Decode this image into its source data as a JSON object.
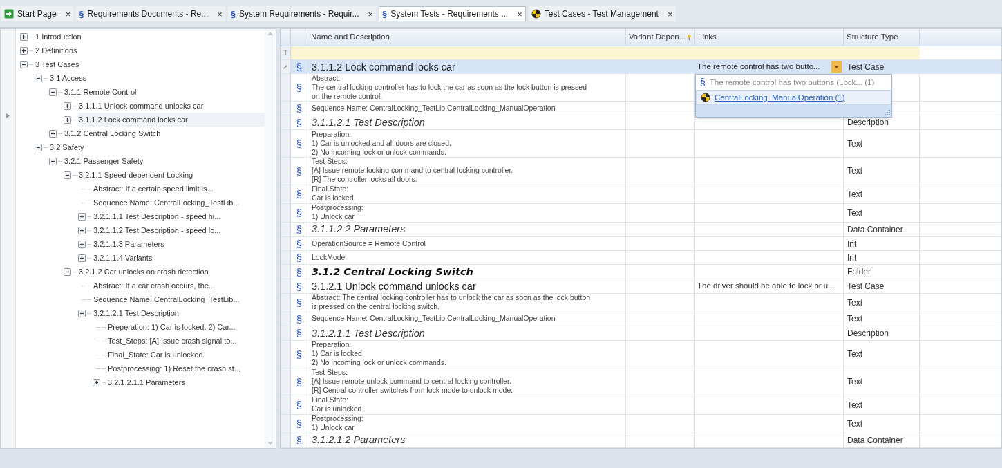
{
  "tabs": [
    {
      "label": "Start Page",
      "kind": "start",
      "selected": false
    },
    {
      "label": "Requirements Documents - Re...",
      "kind": "section",
      "glyph": "§",
      "selected": false
    },
    {
      "label": "System Requirements - Requir...",
      "kind": "section",
      "glyph": "§",
      "selected": false
    },
    {
      "label": "System Tests - Requirements ...",
      "kind": "section",
      "glyph": "§",
      "selected": true
    },
    {
      "label": "Test Cases - Test Management",
      "kind": "testcase",
      "selected": false
    }
  ],
  "tab_close": "×",
  "tree": [
    {
      "label": "1 Introduction",
      "kind": "node",
      "expanded": false,
      "selected": false
    },
    {
      "label": "2 Definitions",
      "kind": "node",
      "expanded": false,
      "selected": false
    },
    {
      "label": "3 Test Cases",
      "kind": "node",
      "expanded": true,
      "selected": false,
      "children": [
        {
          "label": "3.1 Access",
          "kind": "node",
          "expanded": true,
          "selected": false,
          "children": [
            {
              "label": "3.1.1 Remote Control",
              "kind": "node",
              "expanded": true,
              "selected": false,
              "children": [
                {
                  "label": "3.1.1.1 Unlock command unlocks car",
                  "kind": "node",
                  "expanded": false,
                  "selected": false
                },
                {
                  "label": "3.1.1.2 Lock command locks car",
                  "kind": "node",
                  "expanded": false,
                  "selected": true
                }
              ]
            },
            {
              "label": "3.1.2 Central Locking Switch",
              "kind": "node",
              "expanded": false,
              "selected": false
            }
          ]
        },
        {
          "label": "3.2 Safety",
          "kind": "node",
          "expanded": true,
          "selected": false,
          "children": [
            {
              "label": "3.2.1 Passenger Safety",
              "kind": "node",
              "expanded": true,
              "selected": false,
              "children": [
                {
                  "label": "3.2.1.1 Speed-dependent Locking",
                  "kind": "node",
                  "expanded": true,
                  "selected": false,
                  "children": [
                    {
                      "label": "Abstract: If a certain speed limit is...",
                      "kind": "leaf",
                      "selected": false
                    },
                    {
                      "label": "Sequence Name: CentralLocking_TestLib...",
                      "kind": "leaf",
                      "selected": false
                    },
                    {
                      "label": "3.2.1.1.1 Test Description - speed hi...",
                      "kind": "node",
                      "expanded": false,
                      "selected": false
                    },
                    {
                      "label": "3.2.1.1.2 Test Description - speed lo...",
                      "kind": "node",
                      "expanded": false,
                      "selected": false
                    },
                    {
                      "label": "3.2.1.1.3 Parameters",
                      "kind": "node",
                      "expanded": false,
                      "selected": false
                    },
                    {
                      "label": "3.2.1.1.4 Variants",
                      "kind": "node",
                      "expanded": false,
                      "selected": false
                    }
                  ]
                },
                {
                  "label": "3.2.1.2 Car unlocks on crash detection",
                  "kind": "node",
                  "expanded": true,
                  "selected": false,
                  "children": [
                    {
                      "label": "Abstract: If a car crash occurs, the...",
                      "kind": "leaf",
                      "selected": false
                    },
                    {
                      "label": "Sequence Name: CentralLocking_TestLib...",
                      "kind": "leaf",
                      "selected": false
                    },
                    {
                      "label": "3.2.1.2.1 Test Description",
                      "kind": "node",
                      "expanded": true,
                      "selected": false,
                      "children": [
                        {
                          "label": "Preperation: 1) Car is locked. 2) Car...",
                          "kind": "leaf",
                          "selected": false
                        },
                        {
                          "label": "Test_Steps: [A] Issue crash signal to...",
                          "kind": "leaf",
                          "selected": false
                        },
                        {
                          "label": "Final_State: Car is unlocked.",
                          "kind": "leaf",
                          "selected": false
                        },
                        {
                          "label": "Postprocessing: 1) Reset the crash st...",
                          "kind": "leaf",
                          "selected": false
                        },
                        {
                          "label": "3.2.1.2.1.1 Parameters",
                          "kind": "node",
                          "expanded": false,
                          "selected": false
                        }
                      ]
                    }
                  ]
                }
              ]
            }
          ]
        }
      ]
    }
  ],
  "grid": {
    "columns": [
      "Name and Description",
      "Variant Depen...",
      "Links",
      "Structure Type"
    ],
    "rows": [
      {
        "kind": "heading",
        "icon": "§",
        "name": "3.1.1.2 Lock command locks car",
        "links": "The remote control has two butto...",
        "type": "Test Case",
        "selected": true
      },
      {
        "kind": "text",
        "icon": "§",
        "name": "Abstract:\nThe central locking controller has to lock the car as soon as the lock button is pressed\non the remote control.",
        "type": "",
        "selected": false
      },
      {
        "kind": "text",
        "icon": "§",
        "name": "Sequence Name: CentralLocking_TestLib.CentralLocking_ManualOperation",
        "type": "",
        "selected": false
      },
      {
        "kind": "section",
        "icon": "§",
        "name": "3.1.1.2.1 Test Description",
        "type": "Description",
        "selected": false
      },
      {
        "kind": "text",
        "icon": "§",
        "name": "Preparation:\n1) Car is unlocked and all doors are closed.\n2) No incoming lock or unlock commands.",
        "type": "Text",
        "selected": false
      },
      {
        "kind": "text",
        "icon": "§",
        "name": "Test Steps:\n[A] Issue remote locking command to central locking controller.\n[R] The controller locks all doors.",
        "type": "Text",
        "selected": false
      },
      {
        "kind": "text",
        "icon": "§",
        "name": "Final State:\nCar is locked.",
        "type": "Text",
        "selected": false
      },
      {
        "kind": "text",
        "icon": "§",
        "name": "Postprocessing:\n1) Unlock car",
        "type": "Text",
        "selected": false
      },
      {
        "kind": "section",
        "icon": "§",
        "name": "3.1.1.2.2 Parameters",
        "type": "Data Container",
        "selected": false
      },
      {
        "kind": "text",
        "icon": "§",
        "name": "OperationSource = Remote Control",
        "type": "Int",
        "selected": false
      },
      {
        "kind": "text",
        "icon": "§",
        "name": "LockMode",
        "type": "Int",
        "selected": false
      },
      {
        "kind": "folder",
        "icon": "§",
        "name": "3.1.2 Central Locking Switch",
        "type": "Folder",
        "selected": false
      },
      {
        "kind": "heading",
        "icon": "§",
        "name": "3.1.2.1 Unlock command unlocks car",
        "links": "The driver should be able to lock or u...",
        "type": "Test Case",
        "selected": false
      },
      {
        "kind": "text",
        "icon": "§",
        "name": "Abstract: The central locking controller has to unlock the car as soon as the lock button\nis pressed on the central locking switch.",
        "type": "Text",
        "selected": false
      },
      {
        "kind": "text",
        "icon": "§",
        "name": "Sequence Name: CentralLocking_TestLib.CentralLocking_ManualOperation",
        "type": "Text",
        "selected": false
      },
      {
        "kind": "section",
        "icon": "§",
        "name": "3.1.2.1.1 Test Description",
        "type": "Description",
        "selected": false
      },
      {
        "kind": "text",
        "icon": "§",
        "name": "Preparation:\n1) Car is locked\n2) No incoming lock or unlock commands.",
        "type": "Text",
        "selected": false
      },
      {
        "kind": "text",
        "icon": "§",
        "name": "Test Steps:\n[A] Issue remote unlock command to central locking controller.\n[R] Central controller switches from lock mode to unlock mode.",
        "type": "Text",
        "selected": false
      },
      {
        "kind": "text",
        "icon": "§",
        "name": "Final State:\nCar is unlocked",
        "type": "Text",
        "selected": false
      },
      {
        "kind": "text",
        "icon": "§",
        "name": "Postprocessing:\n1) Unlock car",
        "type": "Text",
        "selected": false
      },
      {
        "kind": "section",
        "icon": "§",
        "name": "3.1.2.1.2 Parameters",
        "type": "Data Container",
        "selected": false
      }
    ]
  },
  "links_dropdown": {
    "items": [
      {
        "kind": "requirement",
        "glyph": "§",
        "label": "The remote control has two buttons (Lock... (1)",
        "selected": false
      },
      {
        "kind": "sequence",
        "label": "CentralLocking_ManualOperation (1)",
        "selected": true
      }
    ]
  }
}
